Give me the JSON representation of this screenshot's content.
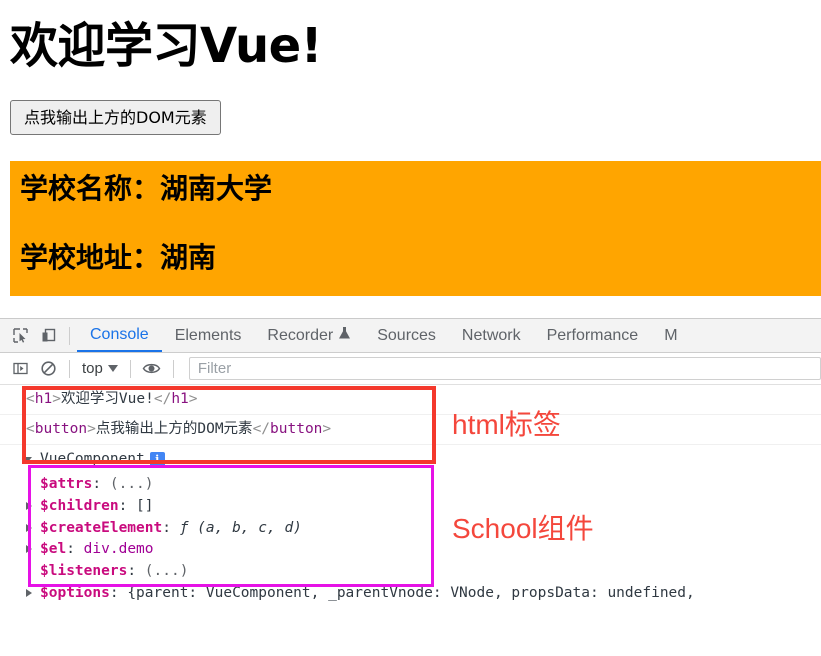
{
  "page": {
    "title": "欢迎学习Vue!",
    "button_label": "点我输出上方的DOM元素",
    "demo": {
      "school_name_line": "学校名称：湖南大学",
      "school_address_line": "学校地址：湖南",
      "background_color": "#ffa500"
    }
  },
  "devtools": {
    "toolbar_icons": [
      {
        "name": "inspect-element-icon",
        "title": "Inspect element"
      },
      {
        "name": "device-toolbar-icon",
        "title": "Toggle device toolbar"
      }
    ],
    "tabs": [
      {
        "label": "Console",
        "active": true
      },
      {
        "label": "Elements",
        "active": false
      },
      {
        "label": "Recorder",
        "active": false,
        "icon": "flask-icon"
      },
      {
        "label": "Sources",
        "active": false
      },
      {
        "label": "Network",
        "active": false
      },
      {
        "label": "Performance",
        "active": false
      },
      {
        "label": "M",
        "active": false
      }
    ],
    "subbar": {
      "sidebar_icon": "console-sidebar-icon",
      "clear_icon": "clear-console-icon",
      "context_value": "top",
      "eye_icon": "live-expression-eye-icon",
      "filter_placeholder": "Filter"
    },
    "accent_color": "#1a73e8"
  },
  "console": {
    "messages": [
      {
        "type": "html",
        "open_punct_1": "<",
        "tag_open": "h1",
        "close_punct_1": ">",
        "text": "欢迎学习Vue!",
        "open_punct_2": "</",
        "tag_close": "h1",
        "close_punct_2": ">"
      },
      {
        "type": "html",
        "open_punct_1": "<",
        "tag_open": "button",
        "close_punct_1": ">",
        "text": "点我输出上方的DOM元素",
        "open_punct_2": "</",
        "tag_close": "button",
        "close_punct_2": ">"
      }
    ],
    "object": {
      "constructor": "VueComponent",
      "info_badge": "i",
      "properties": [
        {
          "name": "$attrs",
          "sep": ": ",
          "value": "(...)",
          "value_kind": "dim",
          "expandable": false
        },
        {
          "name": "$children",
          "sep": ": ",
          "value": "[]",
          "value_kind": "plain",
          "expandable": true
        },
        {
          "name": "$createElement",
          "sep": ": ",
          "value": "ƒ (a, b, c, d)",
          "value_kind": "fn",
          "expandable": true
        },
        {
          "name": "$el",
          "sep": ": ",
          "value": "div.demo",
          "value_kind": "node",
          "expandable": true
        },
        {
          "name": "$listeners",
          "sep": ": ",
          "value": "(...)",
          "value_kind": "dim",
          "expandable": false
        },
        {
          "name": "$options",
          "sep": ": ",
          "value": "{parent: VueComponent, _parentVnode: VNode, propsData: undefined,",
          "value_kind": "plain",
          "expandable": true
        }
      ]
    },
    "annotations": [
      {
        "text": "html标签",
        "color": "#f4473c",
        "target": "html-tags-red-box"
      },
      {
        "text": "School组件",
        "color": "#f4473c",
        "target": "vue-component-magenta-box"
      }
    ],
    "highlight_boxes": [
      {
        "name": "html-tags-red-box",
        "color": "#f4382c"
      },
      {
        "name": "vue-component-magenta-box",
        "color": "#e612e6"
      }
    ]
  }
}
